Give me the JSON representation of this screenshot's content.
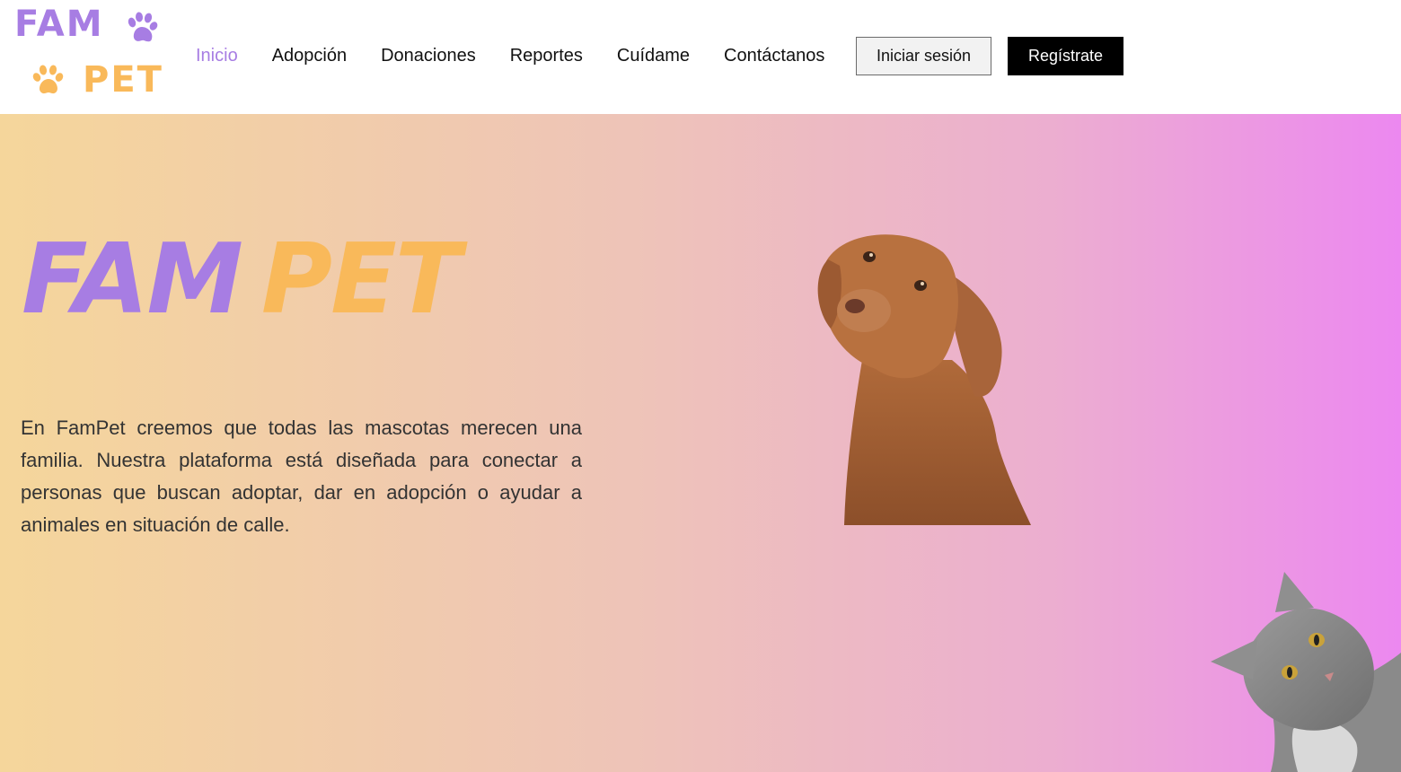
{
  "logo": {
    "line1": "FAM",
    "line2": "PET"
  },
  "nav": {
    "items": [
      {
        "label": "Inicio",
        "active": true
      },
      {
        "label": "Adopción",
        "active": false
      },
      {
        "label": "Donaciones",
        "active": false
      },
      {
        "label": "Reportes",
        "active": false
      },
      {
        "label": "Cuídame",
        "active": false
      },
      {
        "label": "Contáctanos",
        "active": false
      }
    ],
    "login_label": "Iniciar sesión",
    "register_label": "Regístrate"
  },
  "hero": {
    "title_part1": "FAM",
    "title_part2": "PET",
    "description": "En FamPet creemos que todas las mascotas merecen una familia. Nuestra plataforma está diseñada para conectar a personas que buscan adoptar, dar en adopción o ayudar a animales en situación de calle."
  },
  "colors": {
    "accent_purple": "#a77de3",
    "accent_orange": "#f9b95a",
    "gradient_start": "#f5d69b",
    "gradient_end": "#ec88f0"
  },
  "icons": [
    "paw-icon-purple",
    "paw-icon-orange"
  ],
  "images": [
    "dog-photo",
    "cat-photo"
  ]
}
